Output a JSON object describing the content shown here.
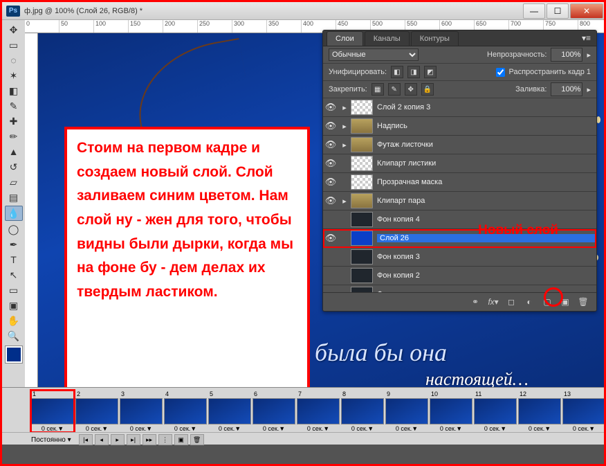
{
  "window": {
    "title": "ф.jpg @ 100% (Слой 26, RGB/8) *"
  },
  "canvas": {
    "text1": "была бы она",
    "text2": "настоящей…"
  },
  "annotation": {
    "instruction": "Стоим на первом кадре и создаем новый слой. Слой заливаем синим цветом. Нам слой ну - жен для того, чтобы видны были дырки, когда мы на фоне бу - дем делах их твердым ластиком.",
    "new_layer_label": "Новый слой"
  },
  "layers_panel": {
    "tabs": [
      "Слои",
      "Каналы",
      "Контуры"
    ],
    "blend_mode": "Обычные",
    "opacity_label": "Непрозрачность:",
    "opacity_value": "100%",
    "unify_label": "Унифицировать:",
    "propagate_label": "Распространить кадр 1",
    "lock_label": "Закрепить:",
    "fill_label": "Заливка:",
    "fill_value": "100%",
    "layers": [
      {
        "name": "Слой 2 копия 3",
        "thumb": "trans",
        "eye": true,
        "arrow": true
      },
      {
        "name": "Надпись",
        "thumb": "folder",
        "eye": true,
        "arrow": true
      },
      {
        "name": "Футаж листочки",
        "thumb": "folder",
        "eye": true,
        "arrow": true
      },
      {
        "name": "Клипарт листики",
        "thumb": "trans",
        "eye": true,
        "arrow": false
      },
      {
        "name": "Прозрачная маска",
        "thumb": "trans",
        "eye": true,
        "arrow": false
      },
      {
        "name": "Клипарт пара",
        "thumb": "folder",
        "eye": true,
        "arrow": true
      },
      {
        "name": "Фон копия 4",
        "thumb": "dark",
        "eye": false,
        "arrow": false
      },
      {
        "name": "Слой 26",
        "thumb": "blue",
        "eye": true,
        "arrow": false,
        "selected": true
      },
      {
        "name": "Фон копия 3",
        "thumb": "dark",
        "eye": false,
        "arrow": false
      },
      {
        "name": "Фон копия 2",
        "thumb": "dark",
        "eye": false,
        "arrow": false
      },
      {
        "name": "Фон копия",
        "thumb": "dark",
        "eye": false,
        "arrow": false
      }
    ]
  },
  "timeline": {
    "loop": "Постоянно ▾",
    "duration": "0 сек.▼",
    "frame_count": 13
  }
}
